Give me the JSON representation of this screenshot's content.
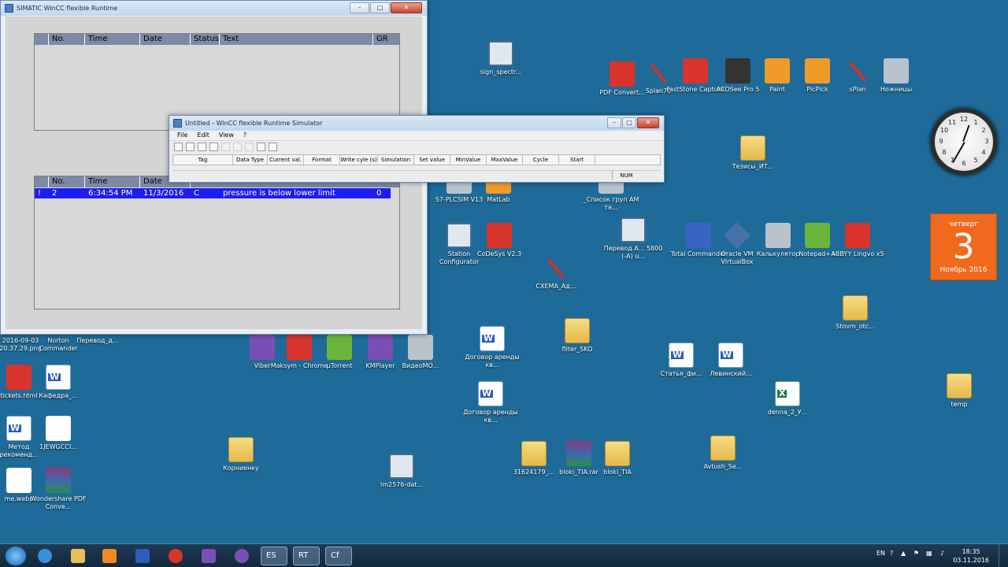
{
  "desktop": {
    "icons": [
      {
        "label": "sign_spectr...",
        "glyph": "g-screen"
      },
      {
        "label": "PDF Convert...",
        "glyph": "g-red"
      },
      {
        "label": "Splan70",
        "glyph": "g-tool"
      },
      {
        "label": "FastStone Capture",
        "glyph": "g-red"
      },
      {
        "label": "ACDSee Pro 5",
        "glyph": "g-camera"
      },
      {
        "label": "Paint",
        "glyph": "g-orange"
      },
      {
        "label": "PicPick",
        "glyph": "g-orange"
      },
      {
        "label": "sPlan",
        "glyph": "g-tool"
      },
      {
        "label": "Ножницы",
        "glyph": "g-gray"
      },
      {
        "label": "Тезисы_ИТ...",
        "glyph": "g-folder"
      },
      {
        "label": "S7-PLCSIM V13",
        "glyph": "g-gray"
      },
      {
        "label": "MatLab",
        "glyph": "g-orange"
      },
      {
        "label": "_Список груп АМ та...",
        "glyph": "g-gray"
      },
      {
        "label": "Station Configurator",
        "glyph": "g-screen"
      },
      {
        "label": "CoDeSys V2.3",
        "glyph": "g-red"
      },
      {
        "label": "Перевод А... 5800 (-А) u...",
        "glyph": "g-screen"
      },
      {
        "label": "Total Commander",
        "glyph": "g-blue"
      },
      {
        "label": "Oracle VM VirtualBox",
        "glyph": "g-vbox"
      },
      {
        "label": "Калькулятор",
        "glyph": "g-gray"
      },
      {
        "label": "Notepad++",
        "glyph": "g-green"
      },
      {
        "label": "ABBYY Lingvo x5",
        "glyph": "g-red"
      },
      {
        "label": "СХЕМА_Ад...",
        "glyph": "g-tool"
      },
      {
        "label": "Stovm_otc...",
        "glyph": "g-folder"
      },
      {
        "label": "2016-09-03 20.37.29.png",
        "glyph": "g-gray"
      },
      {
        "label": "Norton Commander",
        "glyph": "g-blue"
      },
      {
        "label": "Перевод_д...",
        "glyph": "g-word"
      },
      {
        "label": "Viber",
        "glyph": "g-purple"
      },
      {
        "label": "Maksym - Chrome",
        "glyph": "g-red"
      },
      {
        "label": "µTorrent",
        "glyph": "g-green"
      },
      {
        "label": "KMPlayer",
        "glyph": "g-purple"
      },
      {
        "label": "ВидеоМО...",
        "glyph": "g-gray"
      },
      {
        "label": "Договор аренды кв...",
        "glyph": "g-word"
      },
      {
        "label": "filter_SKO",
        "glyph": "g-folder"
      },
      {
        "label": "Статья_фи...",
        "glyph": "g-word"
      },
      {
        "label": "Левинский...",
        "glyph": "g-word"
      },
      {
        "label": "tickets.html",
        "glyph": "g-red"
      },
      {
        "label": "Кафедра_...",
        "glyph": "g-word"
      },
      {
        "label": "Договор аренды кв...",
        "glyph": "g-word"
      },
      {
        "label": "denna_2_У...",
        "glyph": "g-excel"
      },
      {
        "label": "temp",
        "glyph": "g-folder"
      },
      {
        "label": "Метод рекоменд...",
        "glyph": "g-word"
      },
      {
        "label": "1JEWGCCI...",
        "glyph": "g-white"
      },
      {
        "label": "Корниенку",
        "glyph": "g-folder"
      },
      {
        "label": "lm2576-dat...",
        "glyph": "g-screen"
      },
      {
        "label": "31624179_...",
        "glyph": "g-folder"
      },
      {
        "label": "bloki_TIA.rar",
        "glyph": "g-rar"
      },
      {
        "label": "bloki_TIA",
        "glyph": "g-folder"
      },
      {
        "label": "Avtush_Se...",
        "glyph": "g-folder"
      },
      {
        "label": "me.webp",
        "glyph": "g-white"
      },
      {
        "label": "Wondershare PDF Conve...",
        "glyph": "g-rar"
      }
    ]
  },
  "simatic": {
    "title": "SIMATIC WinCC flexible Runtime",
    "alarm_columns": [
      "No.",
      "Time",
      "Date",
      "Status",
      "Text",
      "GR"
    ],
    "pending_row": {
      "flag": "!",
      "no": "2",
      "time": "6:34:54 PM",
      "date": "11/3/2016",
      "status": "C",
      "text": "pressure is below lower limit",
      "gr": "0"
    },
    "columns_lower_visible": [
      "No.",
      "Time",
      "Date"
    ]
  },
  "simulator": {
    "title": "Untitled - WinCC flexible Runtime Simulator",
    "menu": [
      "File",
      "Edit",
      "View",
      "?"
    ],
    "columns": [
      "Tag",
      "Data Type",
      "Current val.",
      "Format",
      "Write cyle (s)",
      "Simulation",
      "Set value",
      "MinValue",
      "MaxValue",
      "Cycle",
      "Start"
    ],
    "status_num": "NUM"
  },
  "gadgets": {
    "clock_numbers": [
      "12",
      "1",
      "2",
      "3",
      "4",
      "5",
      "6",
      "7",
      "8",
      "9",
      "10",
      "11"
    ],
    "calendar": {
      "day_of_week": "четверг",
      "day": "3",
      "month_year": "Ноябрь 2016"
    }
  },
  "taskbar": {
    "language": "EN",
    "time": "18:35",
    "date": "03.11.2016",
    "apps": [
      {
        "name": "Windows Explorer"
      },
      {
        "name": "Internet Explorer"
      },
      {
        "name": "Folder"
      },
      {
        "name": "Media Player"
      },
      {
        "name": "Word"
      },
      {
        "name": "Chrome"
      },
      {
        "name": "KMPlayer"
      },
      {
        "name": "Viber"
      }
    ],
    "wincc_labels": [
      "ES",
      "RT",
      "Cf"
    ]
  },
  "colors": {
    "desktop": "#1e6b9a",
    "alarm_header": "#7e89a6",
    "alarm_selected": "#1d1df2",
    "calendar": "#f06a1d"
  }
}
